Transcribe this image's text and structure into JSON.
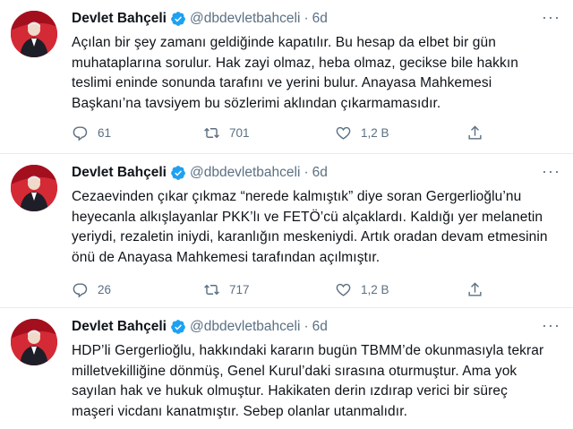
{
  "tweets": [
    {
      "name": "Devlet Bahçeli",
      "handle": "@dbdevletbahceli",
      "separator": "·",
      "time": "6d",
      "text": "Açılan bir şey zamanı geldiğinde kapatılır. Bu hesap da elbet bir gün\nmuhataplarına sorulur. Hak zayi olmaz, heba olmaz, gecikse bile hakkın\nteslimi eninde sonunda tarafını ve yerini bulur. Anayasa Mahkemesi\nBaşkanı’na tavsiyem bu sözlerimi aklından çıkarmamasıdır.",
      "replies": "61",
      "retweets": "701",
      "likes": "1,2 B"
    },
    {
      "name": "Devlet Bahçeli",
      "handle": "@dbdevletbahceli",
      "separator": "·",
      "time": "6d",
      "text": "Cezaevinden çıkar çıkmaz “nerede kalmıştık” diye soran Gergerlioğlu’nu\nheyecanla alkışlayanlar PKK’lı ve FETÖ’cü alçaklardı. Kaldığı yer melanetin\nyeriydi, rezaletin iniydi, karanlığın meskeniydi. Artık oradan devam etmesinin\nönü de Anayasa Mahkemesi tarafından açılmıştır.",
      "replies": "26",
      "retweets": "717",
      "likes": "1,2 B"
    },
    {
      "name": "Devlet Bahçeli",
      "handle": "@dbdevletbahceli",
      "separator": "·",
      "time": "6d",
      "text": "HDP’li Gergerlioğlu, hakkındaki kararın bugün TBMM’de okunmasıyla tekrar\nmilletvekilliğine dönmüş, Genel Kurul’daki sırasına oturmuştur. Ama yok\nsayılan hak ve hukuk olmuştur. Hakikaten derin ızdırap verici bir süreç\nmaşeri vicdanı kanatmıştır. Sebep olanlar utanmalıdır."
    }
  ],
  "colors": {
    "verified": "#1da1f2",
    "secondary_text": "#5b7083",
    "divider": "#e6ecf0",
    "avatar_bg": "#c8102e"
  },
  "icons": [
    "verified-badge-icon",
    "more-icon",
    "reply-icon",
    "retweet-icon",
    "like-icon",
    "share-icon"
  ]
}
